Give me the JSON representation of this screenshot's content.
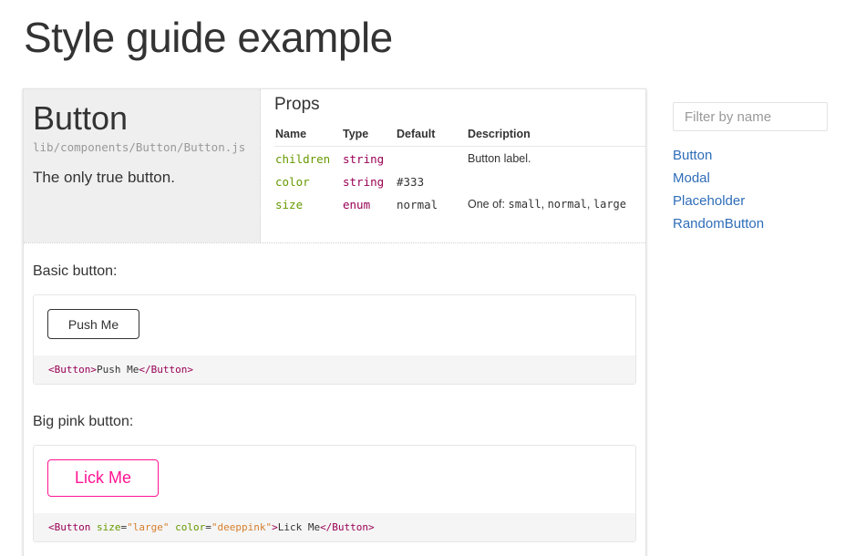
{
  "page": {
    "title": "Style guide example"
  },
  "component": {
    "name": "Button",
    "path": "lib/components/Button/Button.js",
    "description": "The only true button."
  },
  "props": {
    "title": "Props",
    "headers": [
      "Name",
      "Type",
      "Default",
      "Description"
    ],
    "rows": [
      {
        "name": "children",
        "type": "string",
        "default": "",
        "description": "Button label."
      },
      {
        "name": "color",
        "type": "string",
        "default": "#333",
        "description": ""
      },
      {
        "name": "size",
        "type": "enum",
        "default": "normal",
        "description_prefix": "One of: ",
        "description_options": [
          "small",
          "normal",
          "large"
        ]
      }
    ]
  },
  "examples": [
    {
      "label": "Basic button:",
      "button_label": "Push Me",
      "code": {
        "open": "<Button>",
        "text": "Push Me",
        "close": "</Button>"
      }
    },
    {
      "label": "Big pink button:",
      "button_label": "Lick Me",
      "button_color": "#ff1493",
      "code": {
        "tag_open": "<Button",
        "attr1": "size",
        "val1": "\"large\"",
        "attr2": "color",
        "val2": "\"deeppink\"",
        "gt": ">",
        "text": "Lick Me",
        "close": "</Button>"
      }
    }
  ],
  "sidebar": {
    "filter_placeholder": "Filter by name",
    "items": [
      "Button",
      "Modal",
      "Placeholder",
      "RandomButton"
    ]
  },
  "colors": {
    "link": "#2f6db8",
    "prop_name": "#669900",
    "prop_type": "#990055",
    "accent_pink": "#ff1493"
  }
}
